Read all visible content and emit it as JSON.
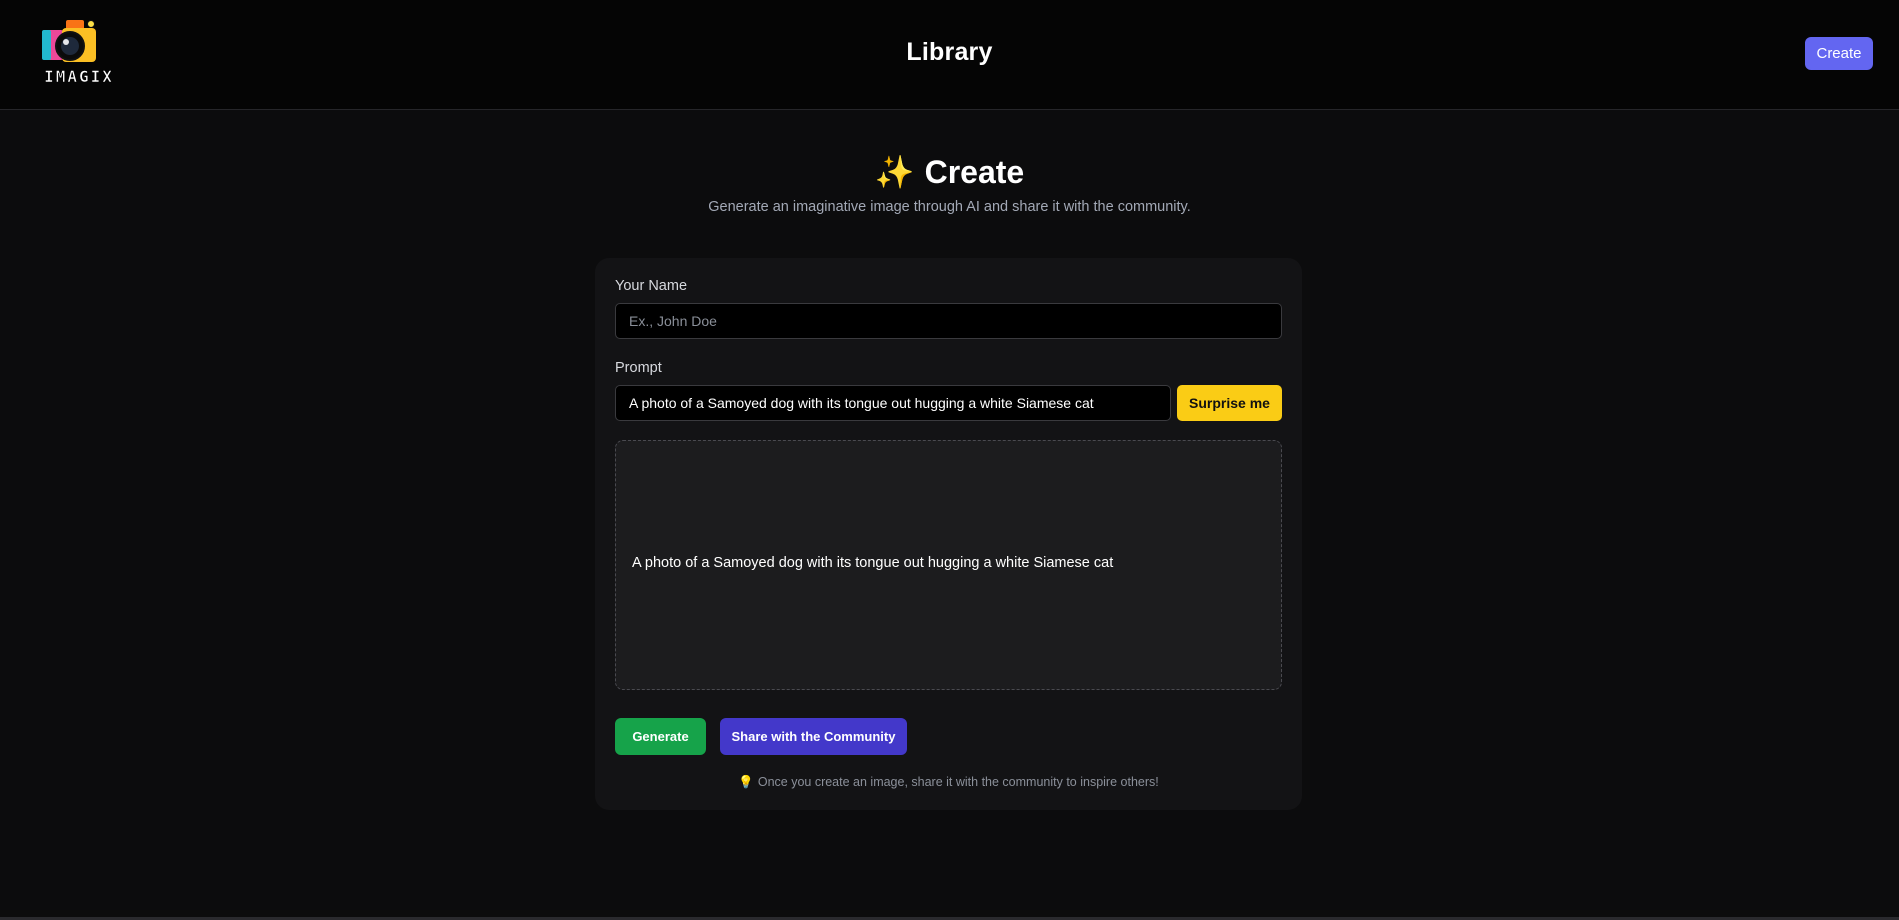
{
  "header": {
    "logo_text": "IMAGIX",
    "title": "Library",
    "create_label": "Create"
  },
  "hero": {
    "icon": "sparkles-icon",
    "sparkle": "✨",
    "title": "Create",
    "subtitle": "Generate an imaginative image through AI and share it with the community."
  },
  "form": {
    "name_label": "Your Name",
    "name_placeholder": "Ex., John Doe",
    "name_value": "",
    "prompt_label": "Prompt",
    "prompt_value": "A photo of a Samoyed dog with its tongue out hugging a white Siamese cat",
    "surprise_label": "Surprise me"
  },
  "preview": {
    "alt_text": "A photo of a Samoyed dog with its tongue out hugging a white Siamese cat"
  },
  "actions": {
    "generate_label": "Generate",
    "share_label": "Share with the Community"
  },
  "tip": {
    "icon": "lightbulb-icon",
    "glyph": "💡",
    "text": "Once you create an image, share it with the community to inspire others!"
  },
  "colors": {
    "accent_create": "#6366f1",
    "surprise": "#facc15",
    "generate": "#16a34a",
    "share": "#4338ca"
  }
}
